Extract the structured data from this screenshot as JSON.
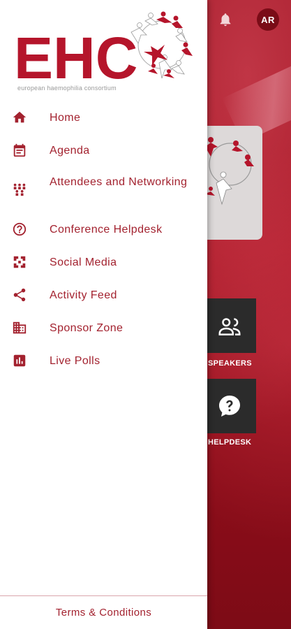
{
  "colors": {
    "brand_red": "#a3222f",
    "logo_red": "#b5152b",
    "drawer_bg": "#ffffff",
    "tile_bg": "#2b2b2b"
  },
  "header": {
    "avatar_initials": "AR",
    "bell_icon": "bell-icon"
  },
  "logo": {
    "wordmark": "EHC",
    "subtitle": "european haemophilia consortium"
  },
  "menu": [
    {
      "label": "Home",
      "icon": "home-icon"
    },
    {
      "label": "Agenda",
      "icon": "calendar-icon"
    },
    {
      "label": "Attendees and Networking",
      "icon": "attendees-icon"
    },
    {
      "label": "Conference Helpdesk",
      "icon": "help-circle-icon"
    },
    {
      "label": "Social Media",
      "icon": "social-icon"
    },
    {
      "label": "Activity Feed",
      "icon": "share-icon"
    },
    {
      "label": "Sponsor Zone",
      "icon": "building-icon"
    },
    {
      "label": "Live Polls",
      "icon": "poll-icon"
    }
  ],
  "footer": {
    "terms_label": "Terms & Conditions"
  },
  "background_tiles": [
    {
      "label": "SPEAKERS",
      "icon": "people-icon"
    },
    {
      "label": "HELPDESK",
      "icon": "question-bubble-icon"
    }
  ]
}
